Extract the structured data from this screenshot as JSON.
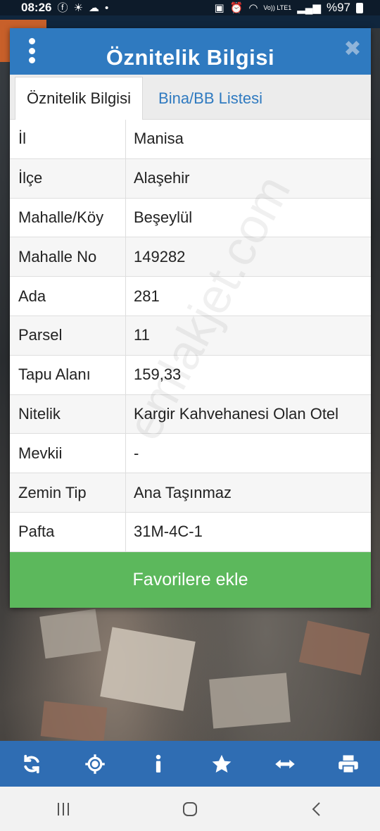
{
  "status_bar": {
    "time": "08:26",
    "battery": "%97",
    "network": "Vo)) LTE1"
  },
  "dialog": {
    "title": "Öznitelik Bilgisi",
    "tabs": [
      {
        "label": "Öznitelik Bilgisi",
        "active": true
      },
      {
        "label": "Bina/BB Listesi",
        "active": false
      }
    ],
    "rows": [
      {
        "key": "İl",
        "value": "Manisa"
      },
      {
        "key": "İlçe",
        "value": "Alaşehir"
      },
      {
        "key": "Mahalle/Köy",
        "value": "Beşeylül"
      },
      {
        "key": "Mahalle No",
        "value": "149282"
      },
      {
        "key": "Ada",
        "value": "281"
      },
      {
        "key": "Parsel",
        "value": "11"
      },
      {
        "key": "Tapu Alanı",
        "value": "159,33"
      },
      {
        "key": "Nitelik",
        "value": "Kargir Kahvehanesi Olan Otel"
      },
      {
        "key": "Mevkii",
        "value": "-"
      },
      {
        "key": "Zemin Tip",
        "value": "Ana Taşınmaz"
      },
      {
        "key": "Pafta",
        "value": "31M-4C-1"
      }
    ],
    "favorite_button": "Favorilere ekle"
  },
  "watermark": "emlakjet.com",
  "toolbar_icons": [
    "refresh-icon",
    "locate-icon",
    "info-icon",
    "star-icon",
    "measure-icon",
    "print-icon"
  ],
  "nav_icons": [
    "recent-apps-icon",
    "home-icon",
    "back-icon"
  ],
  "colors": {
    "header_blue": "#2f7ac0",
    "toolbar_blue": "#2f6db3",
    "favorite_green": "#5cb85c",
    "tab_link": "#2f7ac0"
  }
}
